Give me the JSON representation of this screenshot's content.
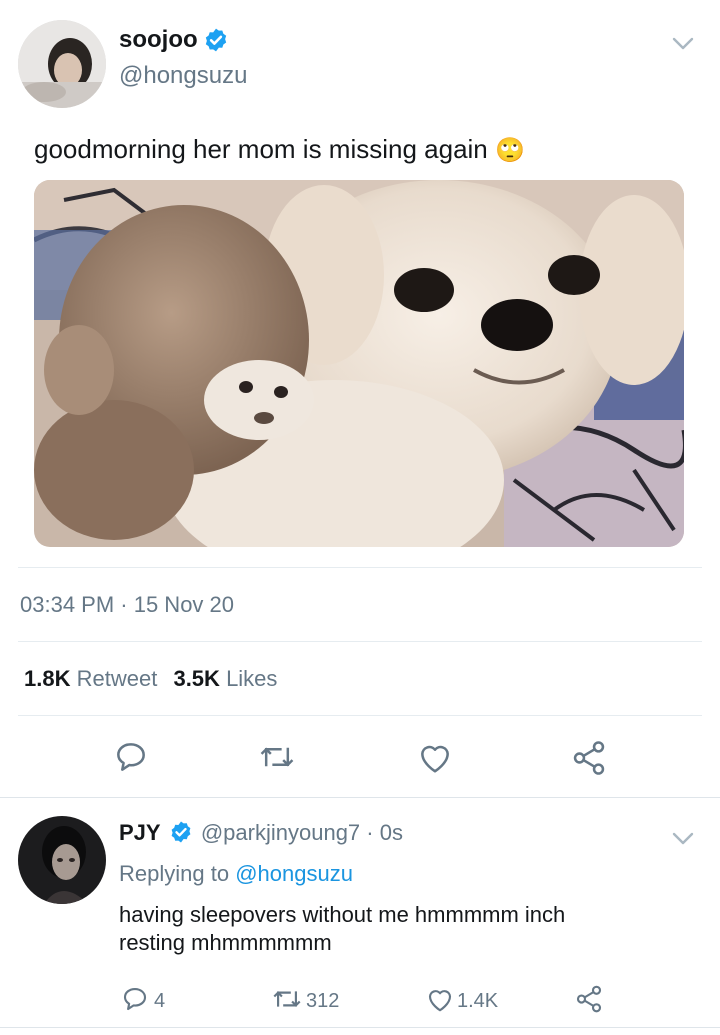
{
  "tweet": {
    "author_name": "soojoo",
    "author_handle": "@hongsuzu",
    "text": "goodmorning her mom is missing again",
    "emoji": "🙄",
    "timestamp": "03:34 PM · 15 Nov 20",
    "retweet_count": "1.8K",
    "retweet_label": "Retweet",
    "like_count": "3.5K",
    "like_label": "Likes"
  },
  "reply": {
    "author_name": "PJY",
    "author_handle": "@parkjinyoung7",
    "time": " · 0s",
    "replying_prefix": "Replying to",
    "replying_to": "@hongsuzu",
    "text_line1": "having sleepovers without me hmmmmm inch",
    "text_line2": "resting mhmmmmmm",
    "reply_count": "4",
    "retweet_count": "312",
    "like_count": "1.4K"
  },
  "colors": {
    "verified": "#1da1f2",
    "link": "#1b95e0",
    "muted": "#657786",
    "icon": "#657786"
  },
  "icons": [
    "verified-badge-icon",
    "chevron-down-icon",
    "reply-icon",
    "retweet-icon",
    "like-icon",
    "share-icon"
  ]
}
